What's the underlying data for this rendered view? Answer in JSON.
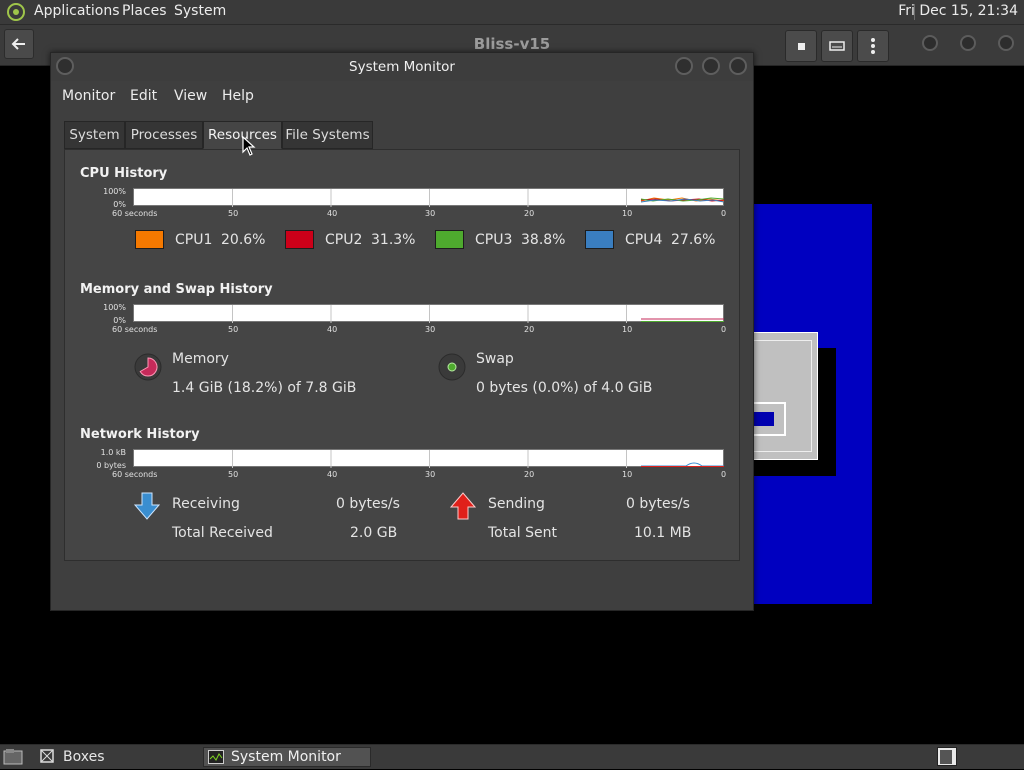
{
  "top_panel": {
    "applications": "Applications",
    "places": "Places",
    "system": "System",
    "clock": "Fri Dec 15, 21:34"
  },
  "boxes": {
    "title": "Bliss-v15"
  },
  "window": {
    "title": "System Monitor",
    "menu": [
      "Monitor",
      "Edit",
      "View",
      "Help"
    ],
    "tabs": [
      "System",
      "Processes",
      "Resources",
      "File Systems"
    ],
    "active_tab": "Resources"
  },
  "graph_axis": {
    "x_ticks": [
      "60 seconds",
      "50",
      "40",
      "30",
      "20",
      "10",
      "0"
    ]
  },
  "cpu": {
    "title": "CPU History",
    "y_top": "100%",
    "y_bottom": "0%",
    "cpus": [
      {
        "label": "CPU1",
        "value": "20.6%",
        "color": "#f57900"
      },
      {
        "label": "CPU2",
        "value": "31.3%",
        "color": "#cc0019"
      },
      {
        "label": "CPU3",
        "value": "38.8%",
        "color": "#4eaa2e"
      },
      {
        "label": "CPU4",
        "value": "27.6%",
        "color": "#3a7ec0"
      }
    ]
  },
  "memory": {
    "title": "Memory and Swap History",
    "y_top": "100%",
    "y_bottom": "0%",
    "memory_label": "Memory",
    "memory_value": "1.4 GiB (18.2%) of 7.8 GiB",
    "memory_color": "#c62a5a",
    "memory_fraction": 0.182,
    "swap_label": "Swap",
    "swap_value": "0 bytes (0.0%) of 4.0 GiB",
    "swap_color": "#4eaa2e"
  },
  "network": {
    "title": "Network History",
    "y_top": "1.0 kB",
    "y_bottom": "0 bytes",
    "receiving_label": "Receiving",
    "receiving_value": "0 bytes/s",
    "total_received_label": "Total Received",
    "total_received_value": "2.0 GB",
    "sending_label": "Sending",
    "sending_value": "0 bytes/s",
    "total_sent_label": "Total Sent",
    "total_sent_value": "10.1 MB",
    "receiving_color": "#3a8ed0",
    "sending_color": "#e0201a"
  },
  "taskbar": {
    "boxes": "Boxes",
    "system_monitor": "System Monitor"
  }
}
